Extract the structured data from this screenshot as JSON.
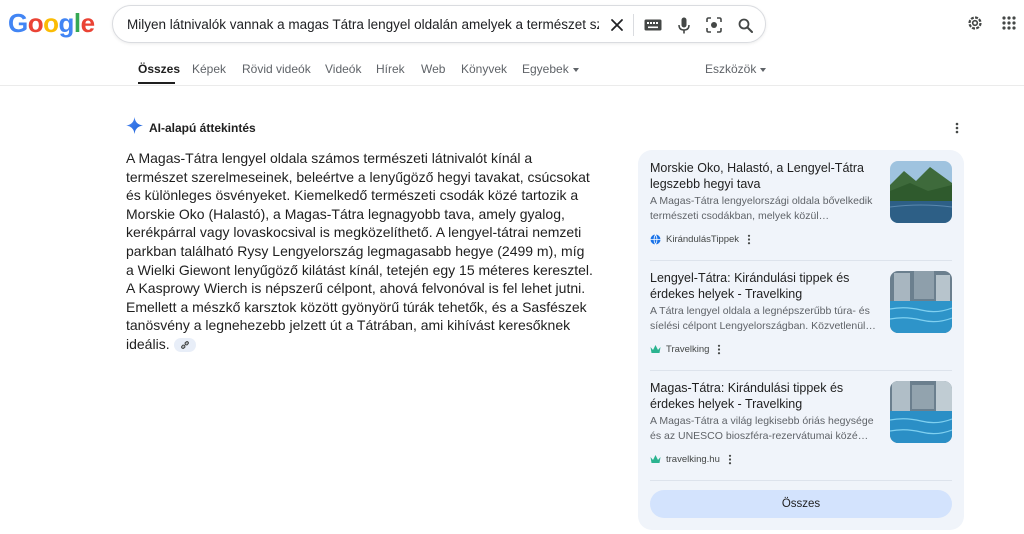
{
  "logo": {
    "letters": [
      "G",
      "o",
      "o",
      "g",
      "l",
      "e"
    ],
    "colors": [
      "#4285F4",
      "#EA4335",
      "#FBBC05",
      "#4285F4",
      "#34A853",
      "#EA4335"
    ]
  },
  "search": {
    "query": "Milyen látnivalók vannak a magas Tátra lengyel oldalán amelyek a természet szerelmes",
    "icons": [
      "close-icon",
      "keyboard-icon",
      "mic-icon",
      "lens-icon",
      "search-icon"
    ]
  },
  "header_icons": [
    "settings-gear-icon",
    "apps-grid-icon"
  ],
  "tabs": [
    {
      "label": "Összes"
    },
    {
      "label": "Képek"
    },
    {
      "label": "Rövid videók"
    },
    {
      "label": "Videók"
    },
    {
      "label": "Hírek"
    },
    {
      "label": "Web"
    },
    {
      "label": "Könyvek"
    },
    {
      "label": "Egyebek"
    }
  ],
  "tools_label": "Eszközök",
  "ai_overview": {
    "title": "AI-alapú áttekintés",
    "body": "A Magas-Tátra lengyel oldala számos természeti látnivalót kínál a természet szerelmeseinek, beleértve a lenyűgöző hegyi tavakat, csúcsokat és különleges ösvényeket. Kiemelkedő természeti csodák közé tartozik a Morskie Oko (Halastó), a Magas-Tátra legnagyobb tava, amely gyalog, kerékpárral vagy lovaskocsival is megközelíthető. A lengyel-tátrai nemzeti parkban található Rysy Lengyelország legmagasabb hegye (2499 m), míg a Wielki Giewont lenyűgöző kilátást kínál, tetején egy 15 méteres keresztel. A Kasprowy Wierch is népszerű célpont, ahová felvonóval is fel lehet jutni. Emellett a mészkő karsztok között gyönyörű túrák tehetők, és a Sasfészek tanösvény a legnehezebb jelzett út a Tátrában, ami kihívást keresőknek ideális."
  },
  "sources": [
    {
      "title": "Morskie Oko, Halastó, a Lengyel-Tátra legszebb hegyi tava",
      "desc": "A Magas-Tátra lengyelországi oldala bővelkedik természeti csodákban, melyek közül…",
      "site": "KirándulásTippek"
    },
    {
      "title": "Lengyel-Tátra: Kirándulási tippek és érdekes helyek - Travelking",
      "desc": "A Tátra lengyel oldala a legnépszerűbb túra- és síelési célpont Lengyelországban. Közvetlenül…",
      "site": "Travelking"
    },
    {
      "title": "Magas-Tátra: Kirándulási tippek és érdekes helyek - Travelking",
      "desc": "A Magas-Tátra a világ legkisebb óriás hegysége és az UNESCO bioszféra-rezervátumai közé…",
      "site": "travelking.hu"
    }
  ],
  "all_button": "Összes"
}
